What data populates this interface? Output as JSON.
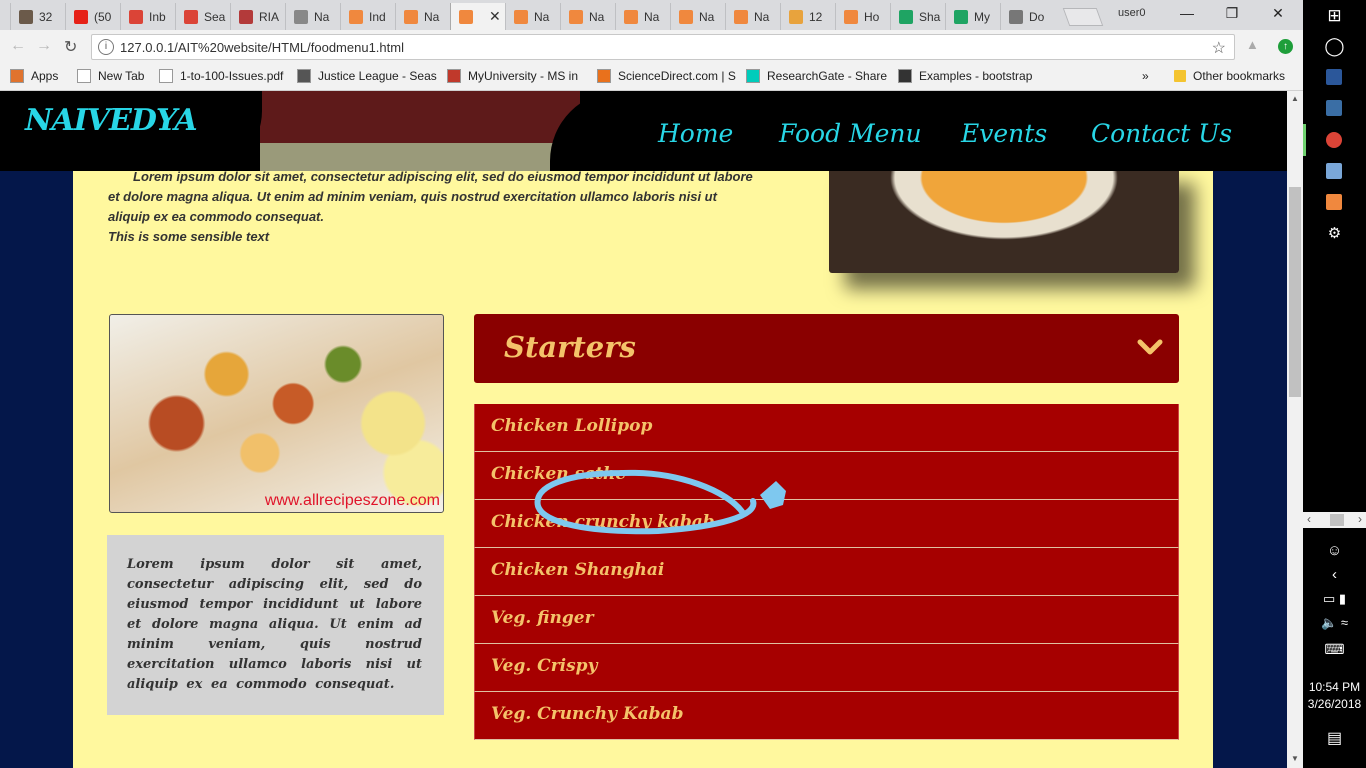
{
  "browser": {
    "tabs": [
      {
        "label": "32",
        "color": "#6b5a4a"
      },
      {
        "label": "(50",
        "color": "#e62117"
      },
      {
        "label": "Inb",
        "color": "#db4437"
      },
      {
        "label": "Sea",
        "color": "#db4437"
      },
      {
        "label": "RIA",
        "color": "#b33a3a"
      },
      {
        "label": "Na",
        "color": "#888888"
      },
      {
        "label": "Ind",
        "color": "#f0883e"
      },
      {
        "label": "Na",
        "color": "#f0883e"
      },
      {
        "label": "",
        "color": "#f0883e",
        "active": true
      },
      {
        "label": "Na",
        "color": "#f0883e"
      },
      {
        "label": "Na",
        "color": "#f0883e"
      },
      {
        "label": "Na",
        "color": "#f0883e"
      },
      {
        "label": "Na",
        "color": "#f0883e"
      },
      {
        "label": "Na",
        "color": "#f0883e"
      },
      {
        "label": "12",
        "color": "#e8a33d"
      },
      {
        "label": "Ho",
        "color": "#f0883e"
      },
      {
        "label": "Sha",
        "color": "#1fa463"
      },
      {
        "label": "My",
        "color": "#1fa463"
      },
      {
        "label": "Do",
        "color": "#777777"
      }
    ],
    "profile_label": "user0",
    "url": "127.0.0.1/AIT%20website/HTML/foodmenu1.html",
    "bookmarks": [
      {
        "label": "Apps",
        "icon": "apps-grid-icon"
      },
      {
        "label": "New Tab",
        "icon": "page-icon"
      },
      {
        "label": "1-to-100-Issues.pdf",
        "icon": "page-icon"
      },
      {
        "label": "Justice League - Seas",
        "icon": "monitor-icon"
      },
      {
        "label": "MyUniversity - MS in",
        "icon": "x-logo-icon"
      },
      {
        "label": "ScienceDirect.com | S",
        "icon": "elsevier-icon"
      },
      {
        "label": "ResearchGate - Share",
        "icon": "researchgate-icon"
      },
      {
        "label": "Examples - bootstrap",
        "icon": "book-icon"
      }
    ],
    "bookmarks_more": "»",
    "other_bookmarks": "Other bookmarks"
  },
  "site": {
    "logo": "NAIVEDYA",
    "nav": [
      "Home",
      "Food Menu",
      "Events",
      "Contact Us"
    ],
    "intro_lines": [
      "Lorem ipsum dolor sit amet, consectetur adipiscing elit, sed do eiusmod tempor incididunt ut labore",
      "et dolore magna aliqua. Ut enim ad minim veniam, quis nostrud exercitation ullamco laboris nisi ut",
      "aliquip ex ea commodo consequat.",
      "This is some sensible text"
    ],
    "image_watermark": "www.allrecipeszone.com",
    "side_text": "Lorem ipsum dolor sit amet, consectetur adipiscing elit, sed do eiusmod tempor incididunt ut labore et dolore magna aliqua. Ut enim ad minim veniam, quis nostrud exercitation ullamco laboris nisi ut aliquip ex ea commodo consequat.",
    "menu": {
      "title": "Starters",
      "items": [
        "Chicken Lollipop",
        "Chicken sathe",
        "Chicken crunchy kabab",
        "Chicken Shanghai",
        "Veg. finger",
        "Veg. Crispy",
        "Veg. Crunchy Kabab"
      ]
    },
    "colors": {
      "accent_cyan": "#28d6e6",
      "menu_red": "#a60000",
      "menu_text": "#f4c36a",
      "content_bg": "#fff89e",
      "annotation_blue": "#7ec8ef"
    }
  },
  "taskbar": {
    "time": "10:54 PM",
    "date": "3/26/2018"
  }
}
